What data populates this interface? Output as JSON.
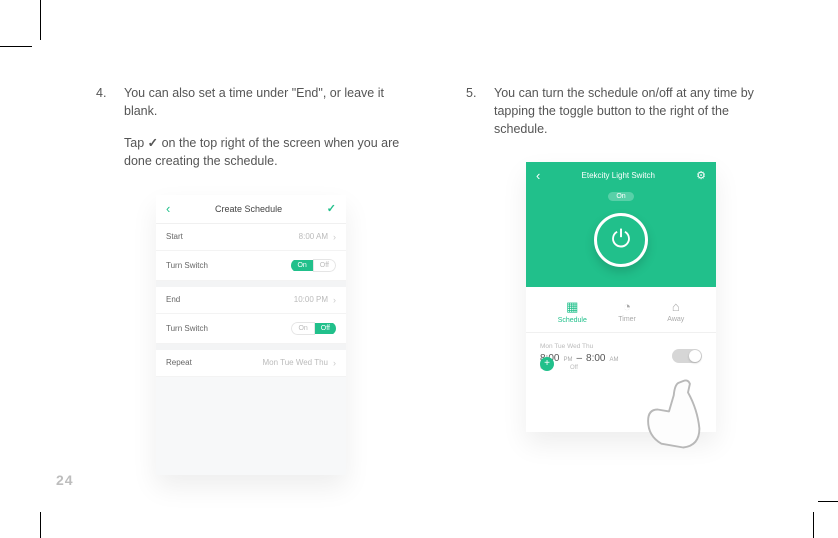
{
  "page_number": "24",
  "steps": {
    "s4": {
      "num": "4.",
      "para1": "You can also set a time under \"End\", or leave it blank.",
      "para2_a": "Tap ",
      "para2_tick": "✓",
      "para2_b": " on the top right of the screen when you are done creating the schedule."
    },
    "s5": {
      "num": "5.",
      "para1": "You can turn the schedule on/off at any time by tapping the toggle button to the right of the schedule."
    }
  },
  "phone1": {
    "title": "Create Schedule",
    "start_label": "Start",
    "start_value": "8:00 AM",
    "turn_switch_label": "Turn Switch",
    "on": "On",
    "off": "Off",
    "end_label": "End",
    "end_value": "10:00 PM",
    "repeat_label": "Repeat",
    "repeat_value": "Mon Tue Wed Thu"
  },
  "phone2": {
    "title": "Etekcity Light Switch",
    "state": "On",
    "tab_schedule": "Schedule",
    "tab_timer": "Timer",
    "tab_away": "Away",
    "days": "Mon Tue Wed Thu",
    "t1": "8:00",
    "t1_ampm": "PM",
    "dash": "–",
    "t2": "8:00",
    "t2_ampm": "AM",
    "sub_on": "On",
    "sub_off": "Off"
  }
}
